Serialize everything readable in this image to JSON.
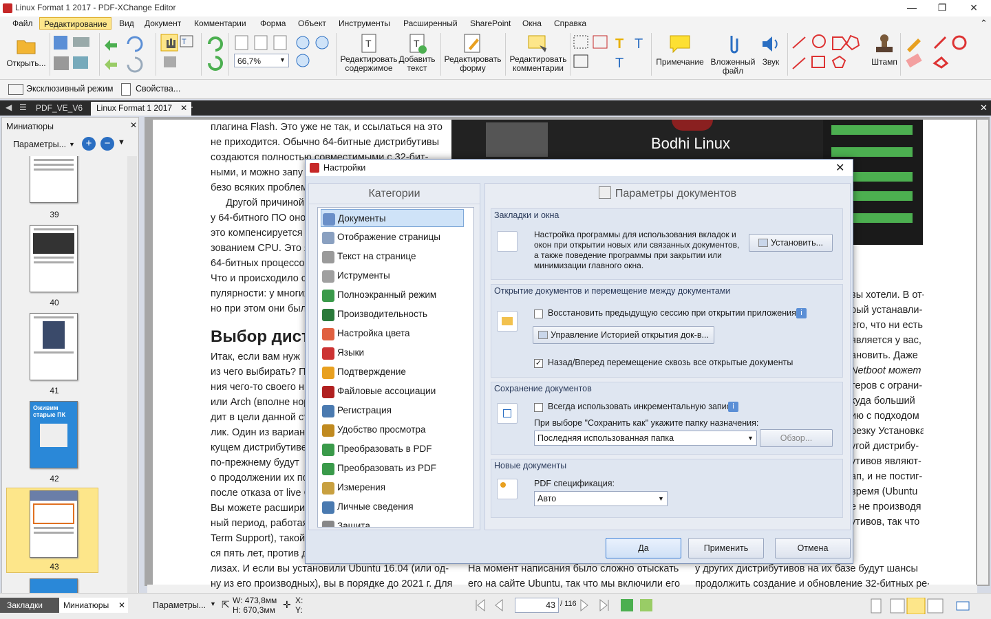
{
  "window": {
    "title": "Linux Format 1 2017 - PDF-XChange Editor",
    "minimize": "—",
    "maximize": "❐",
    "close": "✕"
  },
  "menu": [
    "Файл",
    "Редактирование",
    "Вид",
    "Документ",
    "Комментарии",
    "Форма",
    "Объект",
    "Инструменты",
    "Расширенный",
    "SharePoint",
    "Окна",
    "Справка"
  ],
  "ribbon": {
    "open": "Открыть...",
    "zoom": "66,7%",
    "edit_content": "Редактировать содержимое",
    "add_text": "Добавить текст",
    "edit_form": "Редактировать форму",
    "edit_comments": "Редактировать комментарии",
    "note": "Примечание",
    "attach": "Вложенный файл",
    "sound": "Звук",
    "stamp": "Штамп"
  },
  "subbar": {
    "exclusive": "Эксклюзивный режим",
    "properties": "Свойства..."
  },
  "tabs": [
    "PDF_VE_V6",
    "Linux Format 1 2017"
  ],
  "leftpane": {
    "title": "Миниатюры",
    "params": "Параметры...",
    "pages": [
      "39",
      "40",
      "41",
      "42",
      "43"
    ],
    "thumb_headline": "Оживим старые ПК",
    "tab_bookmarks": "Закладки",
    "tab_thumbs": "Миниатюры"
  },
  "page": {
    "col1": [
      "плагина Flash. Это уже не так, и ссылаться на это",
      "не приходится. Обычно 64-битные дистрибутивы",
      "создаются полностью совместимыми с 32-бит-",
      "ными, и можно запу",
      "безо всяких проблем.",
      "Другой причиной",
      "у 64-битного ПО оно",
      "это компенсируется с",
      "зованием CPU. Это яв",
      "64-битных процессор",
      "Что и происходило с",
      "пулярности: у многих",
      "но при этом они были"
    ],
    "heading": "Выбор дистр",
    "col1b": [
      "Итак, если вам нуж",
      "из чего выбирать? П",
      "ния чего-то своего н",
      "или Arch (вполне норм",
      "дит в цели данной ста",
      "лик. Один из вариант",
      "кущем дистрибутиве,",
      "по-прежнему будут",
      "о продолжении их по",
      "после отказа от live CD",
      "Вы можете расширит",
      "ный период, работая",
      "Term Support), такой к",
      "ся пять лет, против де",
      "лизах. И если вы установили Ubuntu 16.04 (или од-",
      "ну из его производных), вы в порядке до 2021 г. Для"
    ],
    "col2": [
      "На момент написания было сложно отыскать",
      "его на сайте Ubuntu, так что мы включили его"
    ],
    "col3": [
      "вы хотели. В от-",
      "рый устанавли-",
      "его, что ни есть",
      "является у вас,",
      "ановить. Даже",
      "Netboot может",
      "теров с ограни-",
      "куда больший",
      "ию с подходом",
      "резку Установка",
      "",
      "угой дистрибу-",
      "утивов являют-",
      "ап, и не постиг-",
      "время (Ubuntu",
      "е не производя",
      "утивов, так что",
      "у других дистрибутивов на их базе будут шансы",
      "продолжить создание и обновление 32-битных ре-"
    ],
    "bodhi": "Bodhi Linux"
  },
  "status": {
    "params": "Параметры...",
    "w": "W: 473,8мм",
    "h": "H: 670,3мм",
    "x": "X:",
    "y": "Y:",
    "page": "43",
    "total": "/ 116"
  },
  "dialog": {
    "title": "Настройки",
    "categories_head": "Категории",
    "params_head": "Параметры документов",
    "categories": [
      "Документы",
      "Отображение страницы",
      "Текст на странице",
      "Иструменты",
      "Полноэкранный режим",
      "Производительность",
      "Настройка цвета",
      "Языки",
      "Подтверждение",
      "Файловые ассоциации",
      "Регистрация",
      "Удобство просмотра",
      "Преобразовать в PDF",
      "Преобразовать из PDF",
      "Измерения",
      "Личные сведения",
      "Защита"
    ],
    "cat_colors": [
      "#6a8fc8",
      "#8aa0c0",
      "#9a9a9a",
      "#a0a0a0",
      "#3a9a4a",
      "#2a7a3a",
      "#e06040",
      "#cc3333",
      "#e8a020",
      "#b02020",
      "#4a7ab0",
      "#c08a20",
      "#3a9a4a",
      "#3a9a4a",
      "#c8a040",
      "#4a7ab0",
      "#888"
    ],
    "g1": {
      "title": "Закладки и окна",
      "text": [
        "Настройка программы для использования вкладок и",
        "окон при открытии новых или связанных документов,",
        "а также поведение программы при закрытии или",
        "минимизации главного окна."
      ],
      "button": "Установить..."
    },
    "g2": {
      "title": "Открытие документов и перемещение между документами",
      "restore": "Восстановить предыдущую сессию при открытии приложения",
      "history": "Управление Историей открытия док-в...",
      "nav": "Назад/Вперед перемещение сквозь все открытые документы"
    },
    "g3": {
      "title": "Сохранение документов",
      "incremental": "Всегда использовать инкрементальную запись",
      "saveas": "При выборе \"Сохранить как\" укажите папку назначения:",
      "folder": "Последняя использованная папка",
      "browse": "Обзор..."
    },
    "g4": {
      "title": "Новые документы",
      "spec": "PDF спецификация:",
      "value": "Авто"
    },
    "ok": "Да",
    "apply": "Применить",
    "cancel": "Отмена",
    "close": "✕"
  }
}
